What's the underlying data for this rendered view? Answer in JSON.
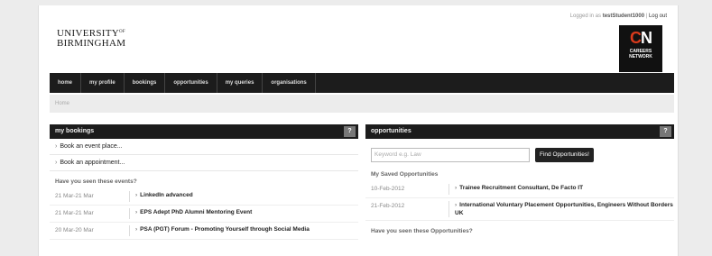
{
  "header": {
    "logo_line1": "UNIVERSITY",
    "logo_of": "OF",
    "logo_line2": "BIRMINGHAM",
    "logged_in_prefix": "Logged in as",
    "username": "testStudent1000",
    "logout": "Log out",
    "badge_big_c": "C",
    "badge_big_n": "N",
    "badge_line1": "CAREERS",
    "badge_line2": "NETWORK"
  },
  "nav": [
    "home",
    "my profile",
    "bookings",
    "opportunities",
    "my queries",
    "organisations"
  ],
  "breadcrumb": "Home",
  "bookings": {
    "title": "my bookings",
    "help": "?",
    "links": [
      "Book an event place...",
      "Book an appointment..."
    ],
    "events_heading": "Have you seen these events?",
    "events": [
      {
        "date": "21 Mar-21 Mar",
        "title": "LinkedIn advanced"
      },
      {
        "date": "21 Mar-21 Mar",
        "title": "EPS Adept PhD Alumni Mentoring Event"
      },
      {
        "date": "20 Mar-20 Mar",
        "title": "PSA (PGT) Forum - Promoting Yourself through Social Media"
      }
    ]
  },
  "opportunities": {
    "title": "opportunities",
    "help": "?",
    "search_placeholder": "Keyword e.g. Law",
    "find_button": "Find Opportunities!",
    "saved_heading": "My Saved Opportunities",
    "saved": [
      {
        "date": "10-Feb-2012",
        "title": "Trainee Recruitment Consultant, De Facto IT"
      },
      {
        "date": "21-Feb-2012",
        "title": "International Voluntary Placement Opportunities, Engineers Without Borders UK"
      }
    ],
    "seen_heading": "Have you seen these Opportunities?"
  },
  "colors": {
    "nav_bg": "#1c1c1c",
    "accent_red": "#d93a1c"
  }
}
